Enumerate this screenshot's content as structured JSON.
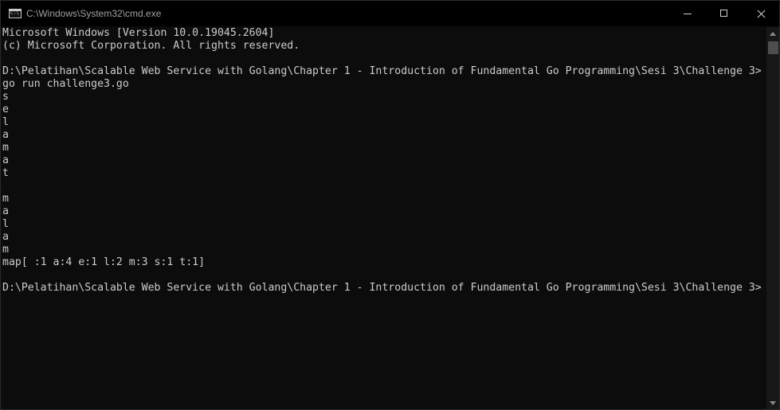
{
  "window": {
    "title": "C:\\Windows\\System32\\cmd.exe",
    "icon": "cmd-icon",
    "controls": {
      "minimize": "minimize-icon",
      "maximize": "maximize-icon",
      "close": "close-icon"
    }
  },
  "console": {
    "lines": [
      "Microsoft Windows [Version 10.0.19045.2604]",
      "(c) Microsoft Corporation. All rights reserved.",
      "",
      "D:\\Pelatihan\\Scalable Web Service with Golang\\Chapter 1 - Introduction of Fundamental Go Programming\\Sesi 3\\Challenge 3>",
      "go run challenge3.go",
      "s",
      "e",
      "l",
      "a",
      "m",
      "a",
      "t",
      "",
      "m",
      "a",
      "l",
      "a",
      "m",
      "map[ :1 a:4 e:1 l:2 m:3 s:1 t:1]",
      "",
      "D:\\Pelatihan\\Scalable Web Service with Golang\\Chapter 1 - Introduction of Fundamental Go Programming\\Sesi 3\\Challenge 3>"
    ]
  },
  "colors": {
    "background": "#0c0c0c",
    "text": "#cccccc",
    "titlebar": "#000000"
  }
}
